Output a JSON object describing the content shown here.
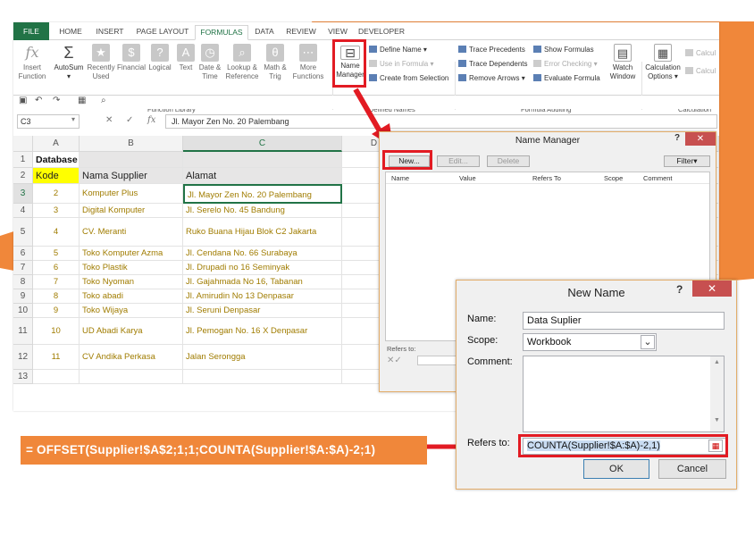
{
  "tabs": [
    "FILE",
    "HOME",
    "INSERT",
    "PAGE LAYOUT",
    "FORMULAS",
    "DATA",
    "REVIEW",
    "VIEW",
    "DEVELOPER"
  ],
  "ribbon": {
    "insert_function": [
      "Insert",
      "Function"
    ],
    "autosum": "AutoSum",
    "recently_used": [
      "Recently",
      "Used"
    ],
    "financial": "Financial",
    "logical": "Logical",
    "text": "Text",
    "date_time": [
      "Date &",
      "Time"
    ],
    "lookup": [
      "Lookup &",
      "Reference"
    ],
    "math": [
      "Math &",
      "Trig"
    ],
    "more": [
      "More",
      "Functions"
    ],
    "name_manager": [
      "Name",
      "Manager"
    ],
    "define_name": "Define Name",
    "use_in_formula": "Use in Formula",
    "create_from_selection": "Create from Selection",
    "trace_precedents": "Trace Precedents",
    "trace_dependents": "Trace Dependents",
    "remove_arrows": "Remove Arrows",
    "show_formulas": "Show Formulas",
    "error_checking": "Error Checking",
    "evaluate_formula": "Evaluate Formula",
    "watch_window": [
      "Watch",
      "Window"
    ],
    "calc_options": [
      "Calculation",
      "Options"
    ],
    "calc_now": "Calcul",
    "calc_sheet": "Calcul",
    "groups": {
      "function_library": "Function Library",
      "defined_names": "Defined Names",
      "formula_auditing": "Formula Auditing",
      "calculation": "Calculation"
    }
  },
  "formula_bar": {
    "name_box": "C3",
    "fx": "fx",
    "content": "Jl. Mayor Zen No. 20 Palembang"
  },
  "columns": [
    "A",
    "B",
    "C",
    "D"
  ],
  "rows": [
    "1",
    "2",
    "3",
    "4",
    "5",
    "6",
    "7",
    "8",
    "9",
    "10",
    "11",
    "12",
    "13"
  ],
  "sheet": {
    "title": "Database Supplier",
    "headers": [
      "Kode",
      "Nama Supplier",
      "Alamat"
    ],
    "data": [
      [
        "2",
        "Komputer Plus",
        "Jl. Mayor Zen No. 20 Palembang"
      ],
      [
        "3",
        "Digital Komputer",
        "Jl. Serelo No. 45 Bandung"
      ],
      [
        "4",
        "CV. Meranti",
        "Ruko Buana Hijau Blok C2 Jakarta"
      ],
      [
        "5",
        "Toko Komputer Azma",
        "Jl. Cendana No. 66 Surabaya"
      ],
      [
        "6",
        "Toko Plastik",
        "Jl. Drupadi no 16 Seminyak"
      ],
      [
        "7",
        "Toko Nyoman",
        "Jl. Gajahmada No 16, Tabanan"
      ],
      [
        "8",
        "Toko abadi",
        "Jl. Amirudin No 13 Denpasar"
      ],
      [
        "9",
        "Toko Wijaya",
        "Jl. Seruni Denpasar"
      ],
      [
        "10",
        "UD Abadi Karya",
        "Jl. Pemogan No. 16 X Denpasar"
      ],
      [
        "11",
        "CV Andika Perkasa",
        "Jalan Serongga"
      ]
    ]
  },
  "name_manager": {
    "title": "Name Manager",
    "help": "?",
    "buttons": {
      "new": "New...",
      "edit": "Edit...",
      "delete": "Delete",
      "filter": "Filter"
    },
    "columns": [
      "Name",
      "Value",
      "Refers To",
      "Scope",
      "Comment"
    ],
    "refers_to_label": "Refers to:"
  },
  "new_name": {
    "title": "New Name",
    "help": "?",
    "name_label": "Name:",
    "name_value": "Data Suplier",
    "scope_label": "Scope:",
    "scope_value": "Workbook",
    "comment_label": "Comment:",
    "refers_label": "Refers to:",
    "refers_value": "COUNTA(Supplier!$A:$A)-2,1)",
    "ok": "OK",
    "cancel": "Cancel"
  },
  "big_formula": "= OFFSET(Supplier!$A$2;1;1;COUNTA(Supplier!$A:$A)-2;1)",
  "colors": {
    "excel_green": "#217346",
    "accent_orange": "#f0873a",
    "highlight_red": "#e21b23",
    "kode_yellow": "#ffff00",
    "data_text": "#a07c00"
  }
}
